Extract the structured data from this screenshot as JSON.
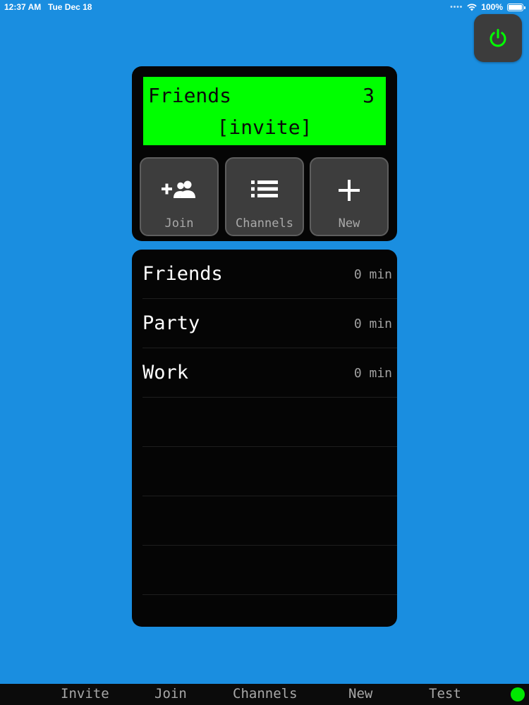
{
  "status_bar": {
    "time": "12:37 AM",
    "date": "Tue Dec 18",
    "battery": "100%",
    "battery_level": 1.0
  },
  "power_button": {
    "icon": "power-icon",
    "color": "#00ff00"
  },
  "lcd": {
    "channel_name": "Friends",
    "user_count": "3",
    "invite_text": "[invite]",
    "background": "#00ff00"
  },
  "actions": {
    "join": {
      "label": "Join",
      "icon": "add-users-icon"
    },
    "channels": {
      "label": "Channels",
      "icon": "list-icon"
    },
    "new": {
      "label": "New",
      "icon": "plus-icon"
    }
  },
  "channels": [
    {
      "name": "Friends",
      "time": "0 min"
    },
    {
      "name": "Party",
      "time": "0 min"
    },
    {
      "name": "Work",
      "time": "0 min"
    },
    {
      "name": "",
      "time": ""
    },
    {
      "name": "",
      "time": ""
    },
    {
      "name": "",
      "time": ""
    },
    {
      "name": "",
      "time": ""
    }
  ],
  "tab_bar": {
    "invite": "Invite",
    "join": "Join",
    "channels": "Channels",
    "new": "New",
    "test": "Test",
    "status_color": "#00e800"
  },
  "colors": {
    "background": "#1a8ee0",
    "panel": "#050505",
    "button": "#3d3d3d"
  }
}
